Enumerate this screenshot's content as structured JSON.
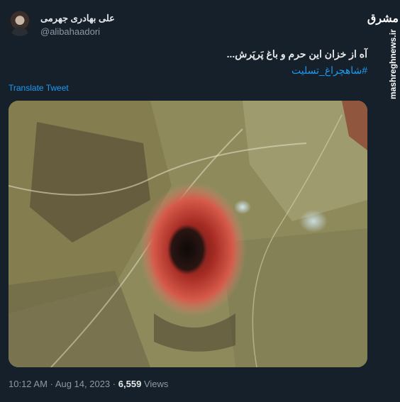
{
  "author": {
    "name": "علی بهادری جهرمی",
    "handle": "@alibahaadori"
  },
  "tweet": {
    "text": "آه از خزان این حرم و باغ پَرپَرش...",
    "hashtag": "#شاهچراغ_تسلیت",
    "translate_label": "Translate Tweet",
    "time": "10:12 AM",
    "separator": "·",
    "date": "Aug 14, 2023",
    "views_count": "6,559",
    "views_label": "Views"
  },
  "watermark": {
    "logo": "مشرق",
    "site": "mashreghnews.ir"
  },
  "media": {
    "description_icon": "photo-icon"
  }
}
